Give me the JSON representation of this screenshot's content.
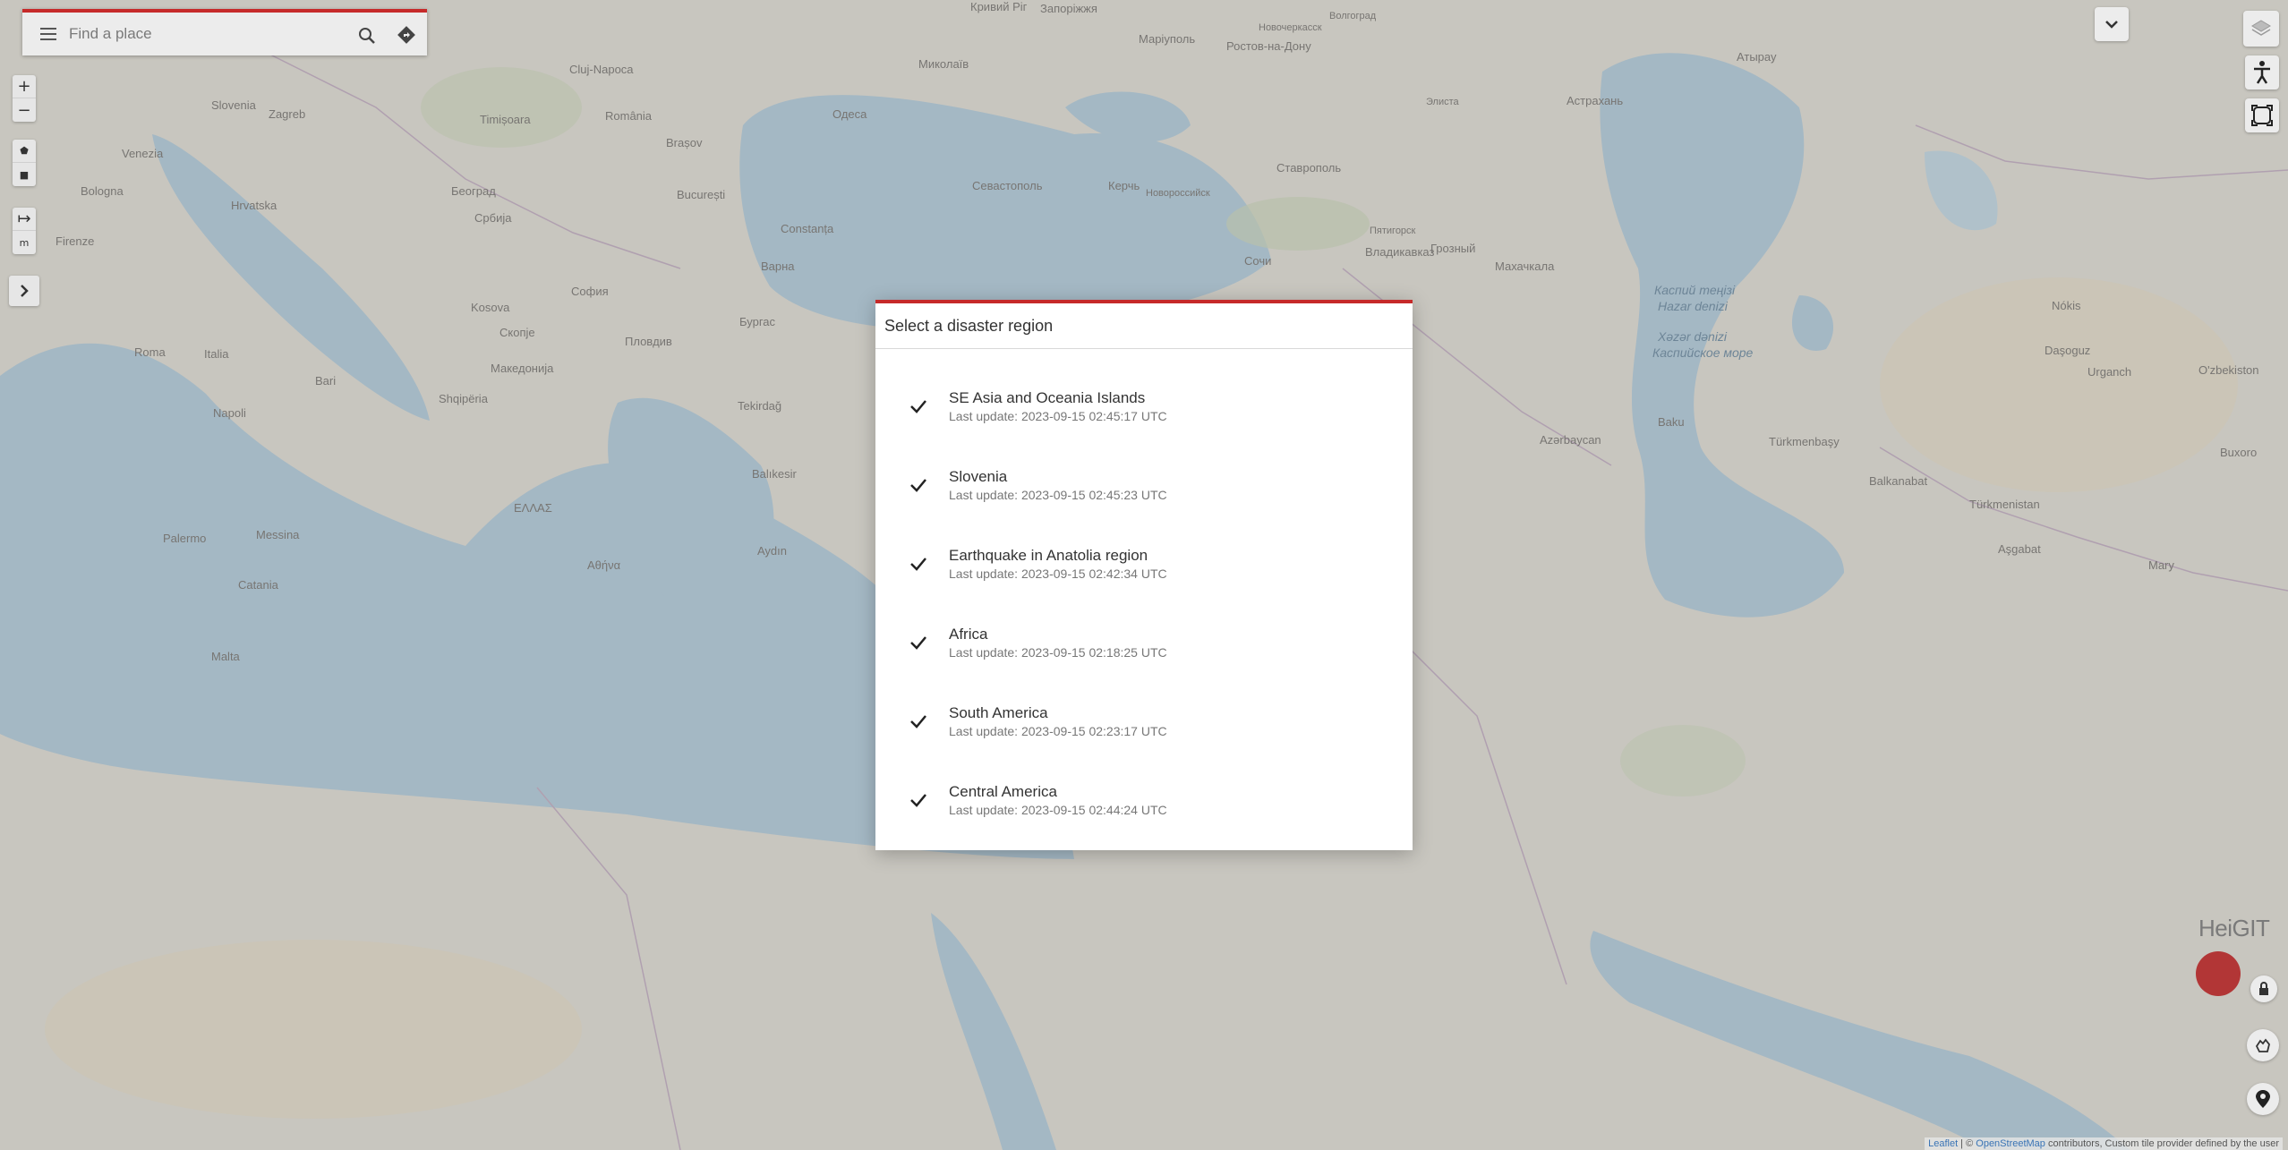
{
  "search": {
    "placeholder": "Find a place"
  },
  "map_controls": {
    "zoom_in": "+",
    "zoom_out": "−",
    "draw_polygon": "⬟",
    "draw_square": "■",
    "measure": "↦",
    "measure_unit": "m"
  },
  "map_labels": [
    {
      "text": "Кривий Ріг"
    },
    {
      "text": "Запоріжжя"
    },
    {
      "text": "Маріуполь"
    },
    {
      "text": "Новочеркасск"
    },
    {
      "text": "Ростов-на-Дону"
    },
    {
      "text": "Волгоград"
    },
    {
      "text": "Астрахань"
    },
    {
      "text": "Атырау"
    },
    {
      "text": "Миколаїв"
    },
    {
      "text": "Одеса"
    },
    {
      "text": "Севастополь"
    },
    {
      "text": "Керчь"
    },
    {
      "text": "Новороссийск"
    },
    {
      "text": "Ставрополь"
    },
    {
      "text": "Элиста"
    },
    {
      "text": "Махачкала"
    },
    {
      "text": "Грозный"
    },
    {
      "text": "Владикавказ"
    },
    {
      "text": "Пятигорск"
    },
    {
      "text": "Сочи"
    },
    {
      "text": "Slovenia"
    },
    {
      "text": "Zagreb"
    },
    {
      "text": "Hrvatska"
    },
    {
      "text": "Venezia"
    },
    {
      "text": "Bologna"
    },
    {
      "text": "Firenze"
    },
    {
      "text": "Roma"
    },
    {
      "text": "Italia"
    },
    {
      "text": "Napoli"
    },
    {
      "text": "Bari"
    },
    {
      "text": "Palermo"
    },
    {
      "text": "Messina"
    },
    {
      "text": "Catania"
    },
    {
      "text": "Malta"
    },
    {
      "text": "Timișoara"
    },
    {
      "text": "Cluj-Napoca"
    },
    {
      "text": "România"
    },
    {
      "text": "Brașov"
    },
    {
      "text": "București"
    },
    {
      "text": "Constanța"
    },
    {
      "text": "Варна"
    },
    {
      "text": "Бургас"
    },
    {
      "text": "Пловдив"
    },
    {
      "text": "София"
    },
    {
      "text": "Београд"
    },
    {
      "text": "Србија"
    },
    {
      "text": "Kosova"
    },
    {
      "text": "Скопје"
    },
    {
      "text": "Македонија"
    },
    {
      "text": "Shqipëria"
    },
    {
      "text": "ΕΛΛΑΣ"
    },
    {
      "text": "Αθήνα"
    },
    {
      "text": "Tekirdağ"
    },
    {
      "text": "Balıkesir"
    },
    {
      "text": "Aydın"
    },
    {
      "text": "Baku"
    },
    {
      "text": "Azərbaycan"
    },
    {
      "text": "Türkmenistan"
    },
    {
      "text": "Aşgabat"
    },
    {
      "text": "Balkanabat"
    },
    {
      "text": "Türkmenbaşy"
    },
    {
      "text": "Nókis"
    },
    {
      "text": "O'zbekiston"
    },
    {
      "text": "Buxoro"
    },
    {
      "text": "Mary"
    },
    {
      "text": "Daşoguz"
    },
    {
      "text": "Urganch"
    }
  ],
  "sea_labels": [
    {
      "text": "Каспий теңізі"
    },
    {
      "text": "Hazar denizi"
    },
    {
      "text": "Xəzər dənizi"
    },
    {
      "text": "Каспийское море"
    }
  ],
  "modal": {
    "title": "Select a disaster region",
    "regions": [
      {
        "name": "SE Asia and Oceania Islands",
        "updated": "Last update: 2023-09-15 02:45:17 UTC"
      },
      {
        "name": "Slovenia",
        "updated": "Last update: 2023-09-15 02:45:23 UTC"
      },
      {
        "name": "Earthquake in Anatolia region",
        "updated": "Last update: 2023-09-15 02:42:34 UTC"
      },
      {
        "name": "Africa",
        "updated": "Last update: 2023-09-15 02:18:25 UTC"
      },
      {
        "name": "South America",
        "updated": "Last update: 2023-09-15 02:23:17 UTC"
      },
      {
        "name": "Central America",
        "updated": "Last update: 2023-09-15 02:44:24 UTC"
      }
    ]
  },
  "branding": {
    "logo": "HeiGIT"
  },
  "attribution": {
    "leaflet": "Leaflet",
    "separator": " | © ",
    "osm": "OpenStreetMap",
    "rest": " contributors, Custom tile provider defined by the user"
  },
  "colors": {
    "accent": "#c62a2a",
    "water": "#a9c3d3",
    "land": "#d8d6cf"
  }
}
